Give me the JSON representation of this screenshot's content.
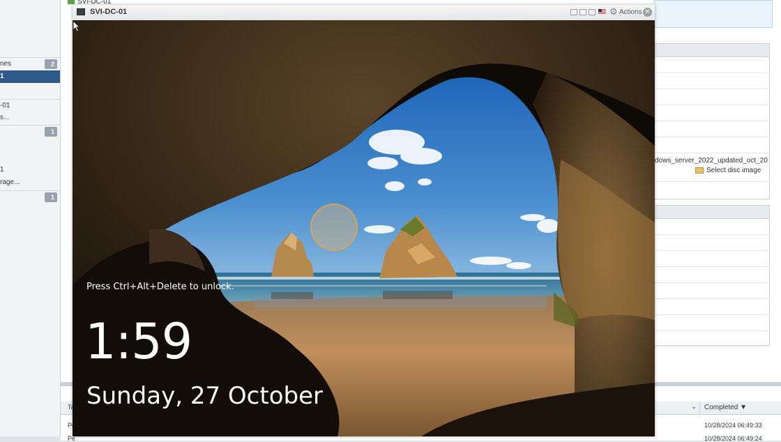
{
  "background_client": {
    "title": "SVI-DC-01",
    "nav": [
      {
        "label": "nes",
        "count": "2",
        "selected": false
      },
      {
        "label": "1",
        "count": "",
        "selected": true
      },
      {
        "label": "-01",
        "count": "",
        "selected": false
      },
      {
        "label": "s...",
        "count": "",
        "selected": false
      },
      {
        "label": "",
        "count": "1",
        "selected": false
      },
      {
        "label": "1",
        "count": "",
        "selected": false
      },
      {
        "label": "rage...",
        "count": "",
        "selected": false
      },
      {
        "label": "",
        "count": "1",
        "selected": false
      }
    ],
    "panel_disc_path": "dows_server_2022_updated_oct_20",
    "select_disc_label": "Select disc image",
    "tasks": {
      "header_first": "Ta",
      "completed_header": "Completed ▼",
      "rows": [
        {
          "cell": "Pe",
          "completed": "10/28/2024 06:49:33"
        },
        {
          "cell": "Pe",
          "completed": "10/28/2024 06:49:24"
        }
      ]
    }
  },
  "console": {
    "title": "SVI-DC-01",
    "actions_label": "Actions",
    "icons": [
      "console-icon",
      "flag-icon",
      "gear-icon",
      "close-icon"
    ]
  },
  "lock_screen": {
    "unlock_hint": "Press Ctrl+Alt+Delete to unlock.",
    "time": "1:59",
    "date": "Sunday, 27 October"
  },
  "colors": {
    "selected_nav": "#2d5a8a",
    "sky": "#3c7fc4",
    "sand": "#b98a55",
    "cave": "#1a130c"
  }
}
